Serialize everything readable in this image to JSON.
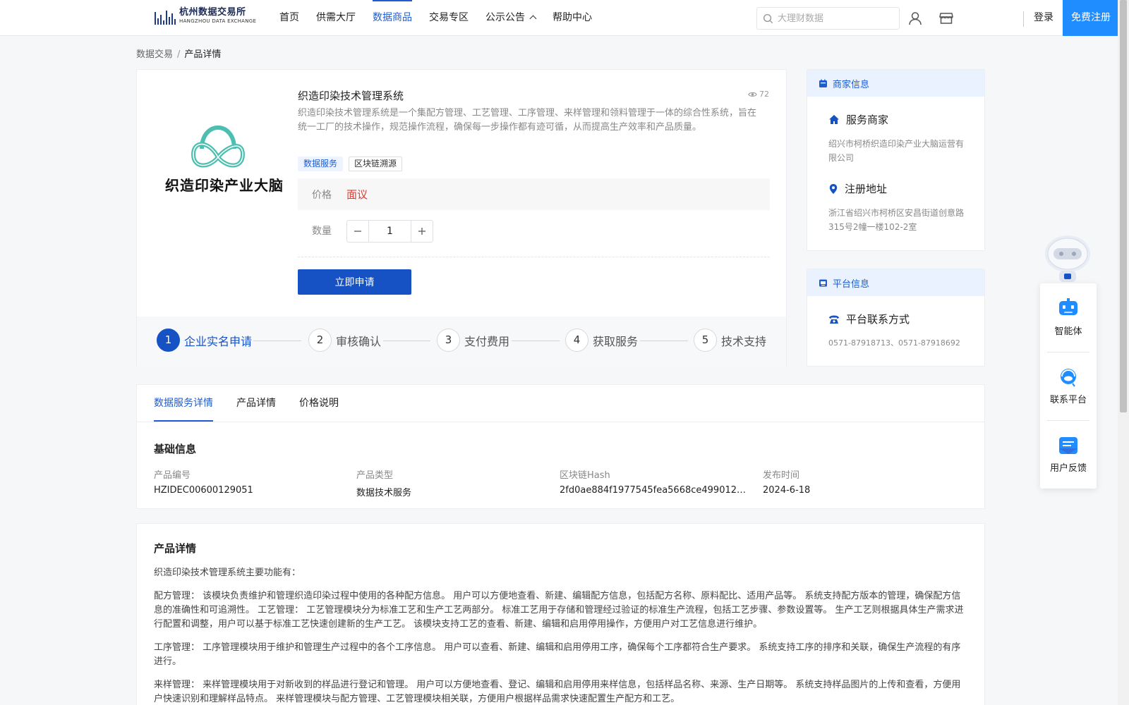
{
  "header": {
    "logo_cn": "杭州数据交易所",
    "logo_en": "HANGZHOU DATA EXCHANGE",
    "nav": [
      {
        "label": "首页",
        "active": false
      },
      {
        "label": "供需大厅",
        "active": false
      },
      {
        "label": "数据商品",
        "active": true
      },
      {
        "label": "交易专区",
        "active": false
      },
      {
        "label": "公示公告",
        "active": false,
        "icon": "chevron-up-icon"
      },
      {
        "label": "帮助中心",
        "active": false
      }
    ],
    "search_placeholder": "大理财数据",
    "login": "登录",
    "register": "免费注册"
  },
  "breadcrumb": {
    "root": "数据交易",
    "sep": "/",
    "current": "产品详情"
  },
  "product": {
    "logo_brand": "织造印染产业大脑",
    "title": "织造印染技术管理系统",
    "views": "72",
    "description": "织造印染技术管理系统是一个集配方管理、工艺管理、工序管理、来样管理和领料管理于一体的综合性系统，旨在统一工厂的技术操作，规范操作流程，确保每一步操作都有迹可循，从而提高生产效率和产品质量。",
    "tags": [
      "数据服务",
      "区块链溯源"
    ],
    "price_label": "价格",
    "price_value": "面议",
    "qty_label": "数量",
    "qty_value": "1",
    "apply_button": "立即申请",
    "steps": [
      {
        "num": "1",
        "label": "企业实名申请",
        "active": true
      },
      {
        "num": "2",
        "label": "审核确认",
        "active": false
      },
      {
        "num": "3",
        "label": "支付费用",
        "active": false
      },
      {
        "num": "4",
        "label": "获取服务",
        "active": false
      },
      {
        "num": "5",
        "label": "技术支持",
        "active": false
      }
    ]
  },
  "merchant": {
    "head": "商家信息",
    "service_title": "服务商家",
    "service_value": "绍兴市柯桥织造印染产业大脑运营有限公司",
    "address_title": "注册地址",
    "address_value": "浙江省绍兴市柯桥区安昌街道创意路315号2幢一楼102-2室"
  },
  "platform": {
    "head": "平台信息",
    "contact_title": "平台联系方式",
    "contact_value": "0571-87918713、0571-87918692"
  },
  "tabs": [
    "数据服务详情",
    "产品详情",
    "价格说明"
  ],
  "basic_info": {
    "title": "基础信息",
    "fields": [
      {
        "key": "产品编号",
        "value": "HZIDEC00600129051"
      },
      {
        "key": "产品类型",
        "value": "数据技术服务"
      },
      {
        "key": "区块链Hash",
        "value": "2fd0ae884f1977545fea5668ce4990128e9..."
      },
      {
        "key": "发布时间",
        "value": "2024-6-18"
      }
    ]
  },
  "details": {
    "title": "产品详情",
    "paragraphs": [
      "织造印染技术管理系统主要功能有：",
      "配方管理： 该模块负责维护和管理织造印染过程中使用的各种配方信息。 用户可以方便地查看、新建、编辑配方信息，包括配方名称、原料配比、适用产品等。 系统支持配方版本的管理，确保配方信息的准确性和可追溯性。 工艺管理： 工艺管理模块分为标准工艺和生产工艺两部分。 标准工艺用于存储和管理经过验证的标准生产流程，包括工艺步骤、参数设置等。 生产工艺则根据具体生产需求进行配置和调整，用户可以基于标准工艺快速创建新的生产工艺。 该模块支持工艺的查看、新建、编辑和启用停用操作，方便用户对工艺信息进行维护。",
      " 工序管理： 工序管理模块用于维护和管理生产过程中的各个工序信息。 用户可以查看、新建、编辑和启用停用工序，确保每个工序都符合生产要求。 系统支持工序的排序和关联，确保生产流程的有序进行。",
      "来样管理： 来样管理模块用于对新收到的样品进行登记和管理。 用户可以方便地查看、登记、编辑和启用停用来样信息，包括样品名称、来源、生产日期等。 系统支持样品图片的上传和查看，方便用户快速识别和理解样品特点。 来样管理模块与配方管理、工艺管理模块相关联，方便用户根据样品需求快速配置生产配方和工艺。"
    ]
  },
  "assistant": {
    "items": [
      "智能体",
      "联系平台",
      "用户反馈"
    ]
  },
  "colors": {
    "accent": "#1e5ccf",
    "primary_button": "#1652c4",
    "register": "#1f8cff",
    "price": "#e03a2f"
  }
}
